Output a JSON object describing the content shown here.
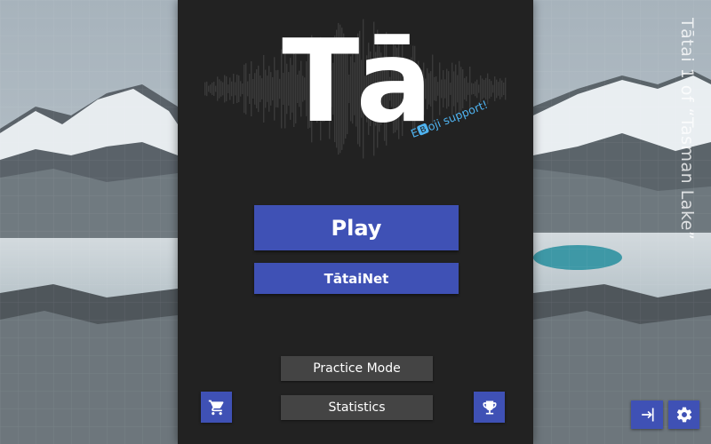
{
  "background": {
    "caption": "Tātai 1 of “Tasman Lake”"
  },
  "logo": {
    "title": "Tā",
    "tagline": "E🅱oji support!"
  },
  "buttons": {
    "play": "Play",
    "tatainet": "TātaiNet",
    "practice": "Practice Mode",
    "statistics": "Statistics"
  },
  "icons": {
    "cart": "cart-icon",
    "trophy": "trophy-icon",
    "exit": "exit-icon",
    "settings": "gear-icon"
  },
  "colors": {
    "accent": "#3f51b5",
    "panel": "#222222",
    "secondary_button": "#444444",
    "tagline": "#4fb3f0"
  }
}
